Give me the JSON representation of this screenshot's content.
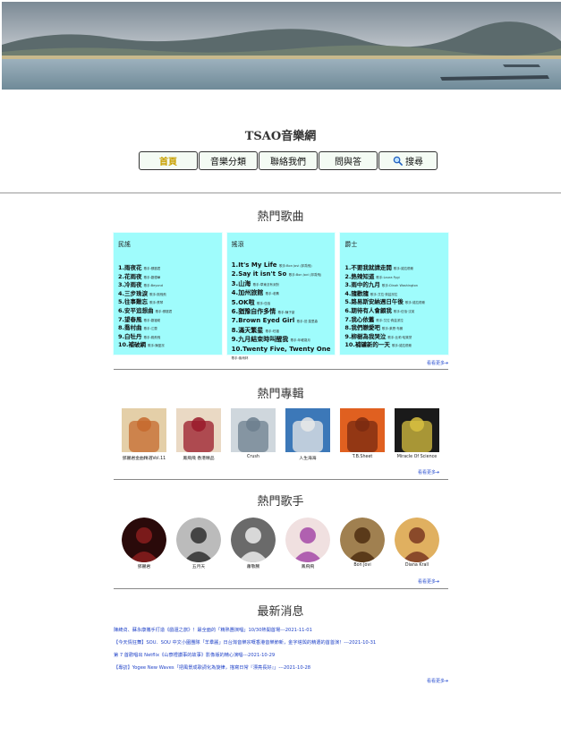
{
  "site_title": "TSAO音樂網",
  "nav": [
    {
      "label": "首頁",
      "active": true
    },
    {
      "label": "音樂分類"
    },
    {
      "label": "聯絡我們"
    },
    {
      "label": "問與答"
    },
    {
      "label": "搜尋",
      "icon": "search-icon"
    }
  ],
  "sections": {
    "songs_title": "熱門歌曲",
    "albums_title": "熱門專輯",
    "artists_title": "熱門歌手",
    "news_title": "最新消息",
    "more_label": "看看更多➔"
  },
  "songs": {
    "folk": {
      "header": "民謠",
      "items": [
        {
          "title": "1.雨夜花",
          "meta": "歌手:鄧麗君"
        },
        {
          "title": "2.花雨夜",
          "meta": "歌手:劉德華"
        },
        {
          "title": "3.冷雨夜",
          "meta": "歌手:Beyond"
        },
        {
          "title": "4.三步珠淚",
          "meta": "歌手:鳳飛飛"
        },
        {
          "title": "5.往事難忘",
          "meta": "歌手:蔡琴"
        },
        {
          "title": "6.安平追想曲",
          "meta": "歌手:鄧麗君"
        },
        {
          "title": "7.望春風",
          "meta": "歌手:劉福助"
        },
        {
          "title": "8.喬村曲",
          "meta": "歌手:江蕙"
        },
        {
          "title": "9.白牡丹",
          "meta": "歌手:鳳飛飛"
        },
        {
          "title": "10.補破網",
          "meta": "歌手:陳盈潔"
        }
      ]
    },
    "rock": {
      "header": "搖滾",
      "items": [
        {
          "title": "1.It's My Life",
          "meta": "歌手:Bon Jovi (邦喬飛)"
        },
        {
          "title": "2.Say it isn't So",
          "meta": "歌手:Bon Jovi (邦喬飛)"
        },
        {
          "title": "3.山海",
          "meta": "歌手:草東沒有派對"
        },
        {
          "title": "4.加州旅館",
          "meta": "歌手:老鷹"
        },
        {
          "title": "5.OK啦",
          "meta": "歌手:伍佰"
        },
        {
          "title": "6.猶豫自作多情",
          "meta": "歌手:陳子豪"
        },
        {
          "title": "7.Brown Eyed Girl",
          "meta": "歌手:范·莫里森"
        },
        {
          "title": "8.滿天繁星",
          "meta": "歌手:旺福"
        },
        {
          "title": "9.九月結束時叫醒我",
          "meta": "歌手:年輕歲月"
        },
        {
          "title": "10.Twenty Five, Twenty One",
          "meta": "歌手:紫雨林"
        }
      ]
    },
    "jazz": {
      "header": "爵士",
      "items": [
        {
          "title": "1.不要我就請走開",
          "meta": "歌手:諾拉瓊斯"
        },
        {
          "title": "2.熱辣知道",
          "meta": "歌手:Laura Fygi"
        },
        {
          "title": "3.雨中的九月",
          "meta": "歌手:Dinah Washington"
        },
        {
          "title": "4.隨歡隨",
          "meta": "歌手:艾拉·費茲潔拉"
        },
        {
          "title": "5.路易斯安納週日午後",
          "meta": "歌手:諾拉瓊斯"
        },
        {
          "title": "6.期待有人會顧我",
          "meta": "歌手:伍佰·沈英"
        },
        {
          "title": "7.我心依舊",
          "meta": "歌手:艾拉·費茲潔拉"
        },
        {
          "title": "8.我們戀愛吧",
          "meta": "歌手:萊恩·布朗"
        },
        {
          "title": "9.柳樹為我哭泣",
          "meta": "歌手:比莉·哈樂黛"
        },
        {
          "title": "10.補罐新的一天",
          "meta": "歌手:諾拉瓊斯"
        }
      ]
    }
  },
  "albums": [
    {
      "caption": "鄧麗君金曲精選Vol.11",
      "colors": [
        "#e4cfa8",
        "#c66a2e"
      ]
    },
    {
      "caption": "鳳飛飛 香港精品",
      "colors": [
        "#ead9c4",
        "#9a1a2a"
      ]
    },
    {
      "caption": "Crush",
      "colors": [
        "#cfd7dd",
        "#6c7f8e"
      ]
    },
    {
      "caption": "人生海海",
      "colors": [
        "#3c78b8",
        "#e8e8e8"
      ]
    },
    {
      "caption": "T.B.Sheet",
      "colors": [
        "#e06020",
        "#7a2a10"
      ]
    },
    {
      "caption": "Miracle Of Science",
      "colors": [
        "#1a1a1a",
        "#d8c040"
      ]
    }
  ],
  "artists": [
    {
      "caption": "鄧麗君",
      "colors": [
        "#7a1a1a",
        "#2a0a0a"
      ]
    },
    {
      "caption": "五月天",
      "colors": [
        "#444444",
        "#bbbbbb"
      ]
    },
    {
      "caption": "蕭敬騰",
      "colors": [
        "#d8d8d8",
        "#6a6a6a"
      ]
    },
    {
      "caption": "鳳飛飛",
      "colors": [
        "#b060b0",
        "#f0e0e0"
      ]
    },
    {
      "caption": "Bon Jovi",
      "colors": [
        "#5a3a1a",
        "#a08050"
      ]
    },
    {
      "caption": "Diana Krall",
      "colors": [
        "#8a4a2a",
        "#e0b060"
      ]
    }
  ],
  "news": [
    "陳綺貞、蘇永康攜手打造《戲還之旅》！最全面的「精熟團演唱」10/30熱開首場---2021-11-01",
    "【今天情狂舞】SOU．SOU 中文小圍團隊「羊羣麗」日台灣音樂宗嘅香港音樂節新，金字塔與的精選的首首演！---2021-10-31",
    "第 7 首歡唱出 Netflix《山寮禮讚事的故事》影像版的精心演唱---2021-10-29",
    "【專訪】Yogee New Waves「把風景成歌詞化為旋律，描寫日常『漂亮長好』」---2021-10-28"
  ]
}
